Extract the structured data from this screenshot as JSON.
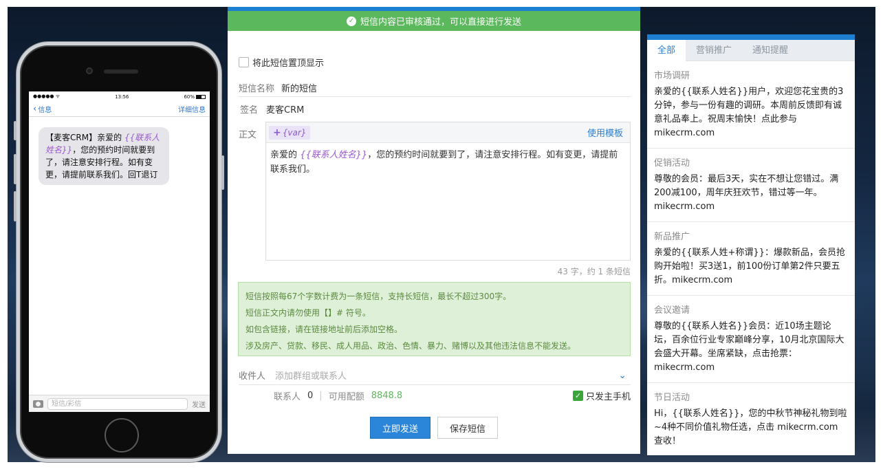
{
  "phone": {
    "status_left": "●●●●● ᯤ",
    "status_time": "13:56",
    "status_battery": "60%",
    "nav_back": "信息",
    "nav_details": "详细信息",
    "bubble_prefix": "【麦客CRM】亲爱的 ",
    "bubble_var": "{{联系人姓名}}",
    "bubble_suffix": "，您的预约时间就要到了，请注意安排行程。如有变更，请提前联系我们。回T退订",
    "compose_placeholder": "短信/彩信",
    "compose_send": "发送"
  },
  "editor_panel": {
    "notice": "短信内容已审核通过，可以直接进行发送",
    "pin_label": "将此短信置顶显示",
    "name_label": "短信名称",
    "name_value": "新的短信",
    "sign_label": "签名",
    "sign_value": "麦客CRM",
    "body_label": "正文",
    "var_button": "{var}",
    "template_link": "使用模板",
    "body_prefix": "亲爱的 ",
    "body_var": "{{联系人姓名}}",
    "body_suffix": "，您的预约时间就要到了，请注意安排行程。如有变更，请提前联系我们。",
    "counter": "43 字，约 1 条短信",
    "rules": [
      "短信按照每67个字数计费为一条短信，支持长短信，最长不超过300字。",
      "短信正文内请勿使用【】# 符号。",
      "如包含链接，请在链接地址前后添加空格。",
      "涉及房产、贷款、移民、成人用品、政治、色情、暴力、赌博以及其他违法信息不能发送。"
    ],
    "recipient_label": "收件人",
    "recipient_placeholder": "添加群组或联系人",
    "contacts_label": "联系人",
    "contacts_count": "0",
    "quota_label": "可用配额",
    "quota_value": "8848.8",
    "only_main_label": "只发主手机",
    "send_button": "立即发送",
    "save_button": "保存短信"
  },
  "templates": {
    "tabs": [
      "全部",
      "营销推广",
      "通知提醒"
    ],
    "items": [
      {
        "category": "市场调研",
        "text": "亲爱的{{联系人姓名}}用户，欢迎您花宝贵的3分钟，参与一份有趣的调研。本周前反馈即有诚意礼品奉上。祝周末愉快！点此参与 mikecrm.com"
      },
      {
        "category": "促销活动",
        "text": "尊敬的会员：最后3天，实在不想让您错过。满200减100，周年庆狂欢节，错过等一年。mikecrm.com"
      },
      {
        "category": "新品推广",
        "text": "亲爱的{{联系人姓+称谓}}：爆款新品，会员抢购开始啦！买3送1，前100份订单第2件只要五折。mikecrm.com"
      },
      {
        "category": "会议邀请",
        "text": "尊敬的{{联系人姓名}}会员：近10场主题论坛，百余位行业专家巅峰分享，10月北京国际大会盛大开幕。坐席紧缺，点击抢票：mikecrm.com"
      },
      {
        "category": "节日活动",
        "text": "Hi，{{联系人姓名}}，您的中秋节神秘礼物到啦~4种不同价值礼物任选，点击 mikecrm.com 查收！"
      }
    ]
  },
  "colors": {
    "accent": "#1d7fd0",
    "success": "#5cb85c",
    "variable": "#9b59d0"
  }
}
